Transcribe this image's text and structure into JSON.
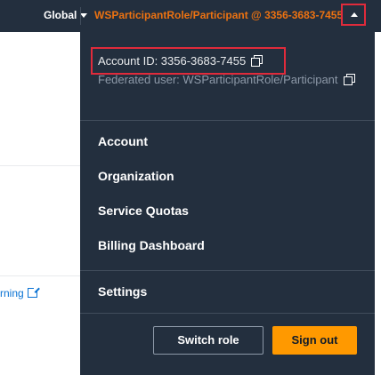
{
  "topbar": {
    "region_label": "Global",
    "account_menu_label": "WSParticipantRole/Participant @ 3356-3683-7455"
  },
  "background": {
    "link_fragment": "rning"
  },
  "dropdown": {
    "account_id": "Account ID: 3356-3683-7455",
    "federated_user": "Federated user: WSParticipantRole/Participant",
    "menu": {
      "account": "Account",
      "organization": "Organization",
      "service_quotas": "Service Quotas",
      "billing_dashboard": "Billing Dashboard",
      "settings": "Settings"
    },
    "buttons": {
      "switch_role": "Switch role",
      "sign_out": "Sign out"
    }
  },
  "colors": {
    "nav_background": "#232f3e",
    "account_menu_text": "#ec7211",
    "highlight_border": "#e02b3b",
    "primary_button": "#ff9900",
    "link": "#0972d3"
  }
}
